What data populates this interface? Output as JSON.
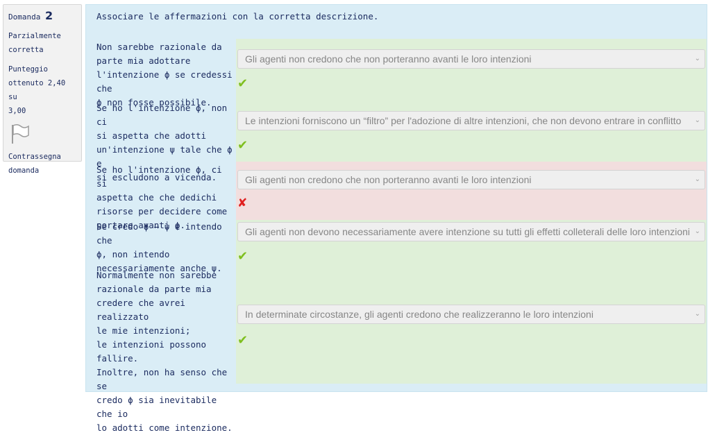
{
  "info": {
    "question_label": "Domanda",
    "question_number": "2",
    "status_line1": "Parzialmente",
    "status_line2": "corretta",
    "score_line1": "Punteggio",
    "score_line2": "ottenuto 2,40 su",
    "score_line3": "3,00",
    "flag_line1": "Contrassegna",
    "flag_line2": "domanda"
  },
  "prompt": "Associare le affermazioni con la corretta descrizione.",
  "rows": [
    {
      "lines": [
        "Non sarebbe razionale da",
        "parte mia adottare",
        "l'intenzione ϕ se credessi che",
        "ϕ non fosse possibile."
      ],
      "answer": "Gli agenti non credono che non porteranno avanti le loro intenzioni",
      "result": "correct",
      "mark": "✔"
    },
    {
      "lines": [
        "Se ho l'intenzione ϕ, non ci",
        "si aspetta che adotti",
        "un'intenzione ψ tale che ϕ e",
        "si escludono a vicenda."
      ],
      "answer": "Le intenzioni forniscono un “filtro” per l'adozione di altre intenzioni, che non devono entrare in conflitto",
      "result": "correct",
      "mark": "✔"
    },
    {
      "lines": [
        "Se ho l'intenzione ϕ, ci si",
        "aspetta che che dedichi",
        "risorse per decidere come",
        "portare avanti ϕ."
      ],
      "answer": "Gli agenti non credono che non porteranno avanti le loro intenzioni",
      "result": "wrong",
      "mark": "✘"
    },
    {
      "lines": [
        "Se credo ϕ → ψ e intendo che",
        "ϕ, non intendo",
        "necessariamente anche ψ."
      ],
      "answer": "Gli agenti non devono necessariamente avere intenzione su tutti gli effetti colleterali delle loro intenzioni",
      "result": "correct",
      "mark": "✔"
    },
    {
      "lines": [
        "Normalmente non sarebbe",
        "razionale da parte mia",
        "credere che avrei realizzato",
        "le mie intenzioni;",
        "le intenzioni possono fallire.",
        "Inoltre, non ha senso che se",
        "credo ϕ sia inevitabile che io",
        "lo adotti come intenzione."
      ],
      "answer": "In determinate circostanze, gli agenti credono che realizzeranno le loro intenzioni",
      "result": "correct",
      "mark": "✔"
    }
  ],
  "icons": {
    "flag": "flag-icon",
    "chevron": "chevron-down-icon",
    "correct": "check-icon",
    "incorrect": "cross-icon"
  },
  "colors": {
    "correct_bg": "#dff0d8",
    "wrong_bg": "#f2dede",
    "panel_bg": "#daedf6",
    "text": "#1c2c60"
  }
}
